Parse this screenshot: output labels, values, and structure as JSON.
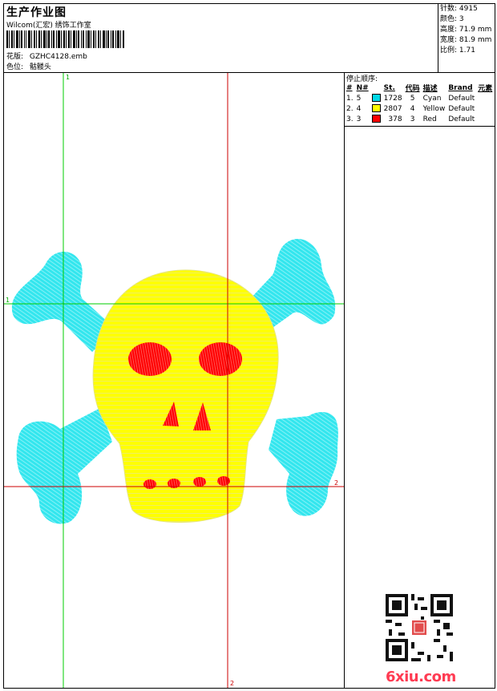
{
  "header": {
    "title": "生产作业图",
    "company": "Wilcom(汇宏) 绣饰工作室",
    "design_label": "花版:",
    "design_value": "GZHC4128.emb",
    "color_label": "色位:",
    "color_value": "骷髅头"
  },
  "stats": {
    "stitches_label": "针数:",
    "stitches": "4915",
    "colors_label": "颜色:",
    "colors": "3",
    "height_label": "高度:",
    "height": "71.9 mm",
    "width_label": "宽度:",
    "width": "81.9 mm",
    "ratio_label": "比例:",
    "ratio": "1.71"
  },
  "stop_sequence": {
    "title": "停止顺序:",
    "columns": [
      "#",
      "N#",
      "St.",
      "代码",
      "描述",
      "Brand",
      "元素"
    ],
    "rows": [
      {
        "idx": "1.",
        "n": "5",
        "color": "#00d8e8",
        "st": "1728",
        "code": "5",
        "desc": "Cyan",
        "brand": "Default"
      },
      {
        "idx": "2.",
        "n": "4",
        "color": "#ffff00",
        "st": "2807",
        "code": "4",
        "desc": "Yellow",
        "brand": "Default"
      },
      {
        "idx": "3.",
        "n": "3",
        "color": "#ff0000",
        "st": "378",
        "code": "3",
        "desc": "Red",
        "brand": "Default"
      }
    ]
  },
  "guides": {
    "label_1": "1",
    "label_2": "2"
  },
  "watermark": "6xiu.com",
  "colors": {
    "cyan": "#33e6ee",
    "yellow": "#ffff00",
    "red": "#ff0000",
    "guide_green": "#00cc00",
    "guide_red": "#cc0000"
  }
}
